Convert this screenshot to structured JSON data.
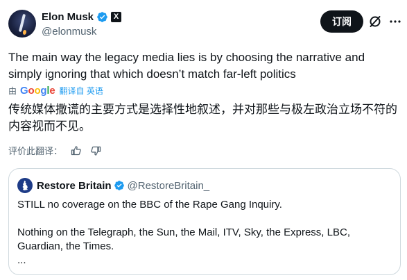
{
  "author": {
    "display_name": "Elon Musk",
    "handle": "@elonmusk",
    "badge": "X"
  },
  "actions": {
    "subscribe_label": "订阅",
    "grok_icon": "grok-slash-circle-icon",
    "more_icon": "more-icon"
  },
  "tweet": {
    "text": "The main way the legacy media lies is by choosing the narrative and simply ignoring that which doesn’t match far-left politics"
  },
  "translation": {
    "by_label": "由",
    "provider": "Google",
    "translate_from_label": "翻译自 英语",
    "text": "传统媒体撒谎的主要方式是选择性地叙述，并对那些与极左政治立场不符的内容视而不见。",
    "rate_label": "评价此翻译：",
    "thumbs_up_icon": "thumbs-up-icon",
    "thumbs_down_icon": "thumbs-down-icon"
  },
  "quote": {
    "display_name": "Restore Britain",
    "handle": "@RestoreBritain_",
    "text": "STILL no coverage on the BBC of the Rape Gang Inquiry.\n\nNothing on the Telegraph, the Sun, the Mail, ITV, Sky, the Express, LBC, Guardian, the Times.\n..."
  },
  "colors": {
    "text": "#0f1419",
    "secondary": "#536471",
    "link": "#1d9bf0",
    "verified": "#1d9bf0",
    "border": "#cfd9de",
    "button_bg": "#0f1419"
  }
}
